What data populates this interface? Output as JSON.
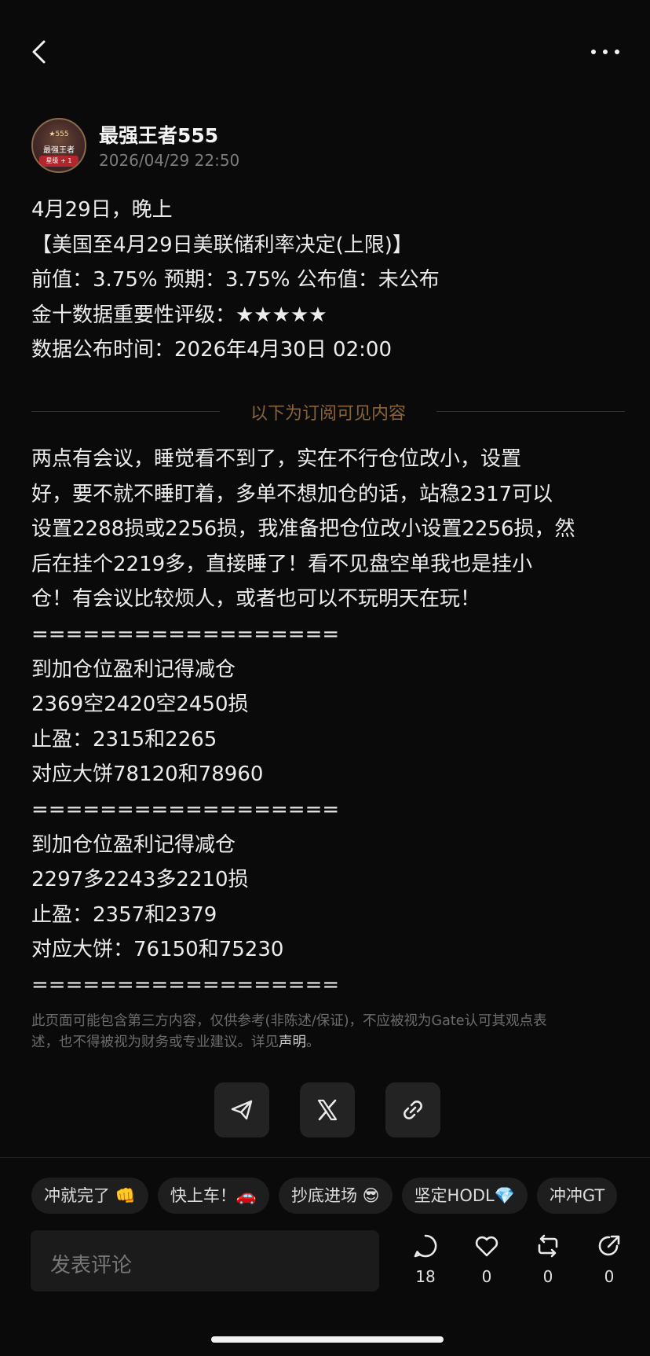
{
  "header": {
    "back_icon": "chevron-left-icon",
    "more_icon": "more-dots-icon"
  },
  "author": {
    "avatar_badge_top": "★555",
    "avatar_badge_mid": "最强王者",
    "avatar_badge_bottom": "星级 + 1",
    "name": "最强王者555",
    "time": "2026/04/29 22:50"
  },
  "post": {
    "lines": [
      "4月29日，晚上",
      "【美国至4月29日美联储利率决定(上限)】",
      "前值：3.75% 预期：3.75% 公布值：未公布",
      "金十数据重要性评级：★★★★★",
      "数据公布时间：2026年4月30日 02:00"
    ],
    "subscriber_divider": "以下为订阅可见内容",
    "subscriber_lines": [
      "两点有会议，睡觉看不到了，实在不行仓位改小，设置",
      "好，要不就不睡盯着，多单不想加仓的话，站稳2317可以",
      "设置2288损或2256损，我准备把仓位改小设置2256损，然",
      "后在挂个2219多，直接睡了！看不见盘空单我也是挂小",
      "仓！有会议比较烦人，或者也可以不玩明天在玩！",
      "==================",
      "到加仓位盈利记得减仓",
      "2369空2420空2450损",
      "止盈：2315和2265",
      "对应大饼78120和78960",
      "==================",
      "到加仓位盈利记得减仓",
      "2297多2243多2210损",
      "止盈：2357和2379",
      "对应大饼：76150和75230",
      "=================="
    ]
  },
  "disclaimer": {
    "text_line1": "此页面可能包含第三方内容，仅供参考(非陈述/保证)，不应被视为Gate认可其观点表",
    "text_line2": "述，也不得被视为财务或专业建议。详见",
    "link": "声明",
    "end": "。"
  },
  "share": {
    "icons": [
      "telegram-icon",
      "x-icon",
      "link-icon"
    ]
  },
  "chips": [
    "冲就完了 👊",
    "快上车！🚗",
    "抄底进场 😎",
    "坚定HODL💎",
    "冲冲GT"
  ],
  "comment": {
    "placeholder": "发表评论"
  },
  "actions": {
    "comment_count": "18",
    "like_count": "0",
    "repost_count": "0",
    "share_count": "0"
  }
}
